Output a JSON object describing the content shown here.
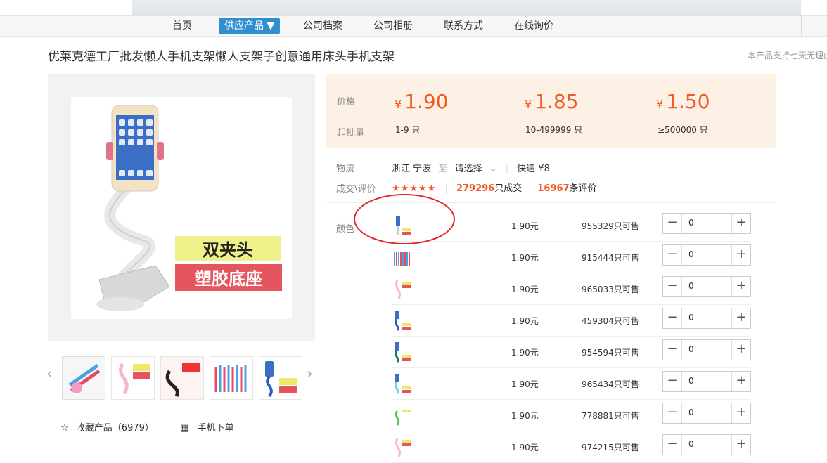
{
  "nav": {
    "items": [
      "首页",
      "供应产品 ▼",
      "公司档案",
      "公司相册",
      "联系方式",
      "在线询价"
    ]
  },
  "title": "优莱克德工厂批发懒人手机支架懒人支架子创意通用床头手机支架",
  "promise": "本产品支持七天无理由",
  "image_badges": {
    "line1": "双夹头",
    "line2": "塑胶底座"
  },
  "price_box": {
    "price_label": "价格",
    "moq_label": "起批量",
    "tiers": [
      {
        "currency": "¥",
        "price": "1.90",
        "qty": "1-9 只"
      },
      {
        "currency": "¥",
        "price": "1.85",
        "qty": "10-499999 只"
      },
      {
        "currency": "¥",
        "price": "1.50",
        "qty": "≥500000 只"
      }
    ]
  },
  "logistics": {
    "label": "物流",
    "from": "浙江 宁波",
    "to_word": "至",
    "select": "请选择",
    "express": "快递 ¥8"
  },
  "deals": {
    "label": "成交\\评价",
    "stars": "★★★★★",
    "rating": 4.5,
    "sold_count": "279296",
    "sold_suffix": "只成交",
    "review_count": "16967",
    "review_suffix": "条评价"
  },
  "color_label": "颜色",
  "skus": [
    {
      "price": "1.90元",
      "stock": "955329只可售",
      "qty": "0"
    },
    {
      "price": "1.90元",
      "stock": "915444只可售",
      "qty": "0"
    },
    {
      "price": "1.90元",
      "stock": "965033只可售",
      "qty": "0"
    },
    {
      "price": "1.90元",
      "stock": "459304只可售",
      "qty": "0"
    },
    {
      "price": "1.90元",
      "stock": "954594只可售",
      "qty": "0"
    },
    {
      "price": "1.90元",
      "stock": "965434只可售",
      "qty": "0"
    },
    {
      "price": "1.90元",
      "stock": "778881只可售",
      "qty": "0"
    },
    {
      "price": "1.90元",
      "stock": "974215只可售",
      "qty": "0"
    }
  ],
  "stepper": {
    "minus": "−",
    "plus": "+"
  },
  "actions": {
    "favorite": "收藏产品（6979）",
    "mobile": "手机下单"
  },
  "colors": {
    "accent": "#f15a22",
    "nav_active": "#2f8fd1",
    "price_bg": "#fdf0e4",
    "annotation": "#e3242b"
  }
}
